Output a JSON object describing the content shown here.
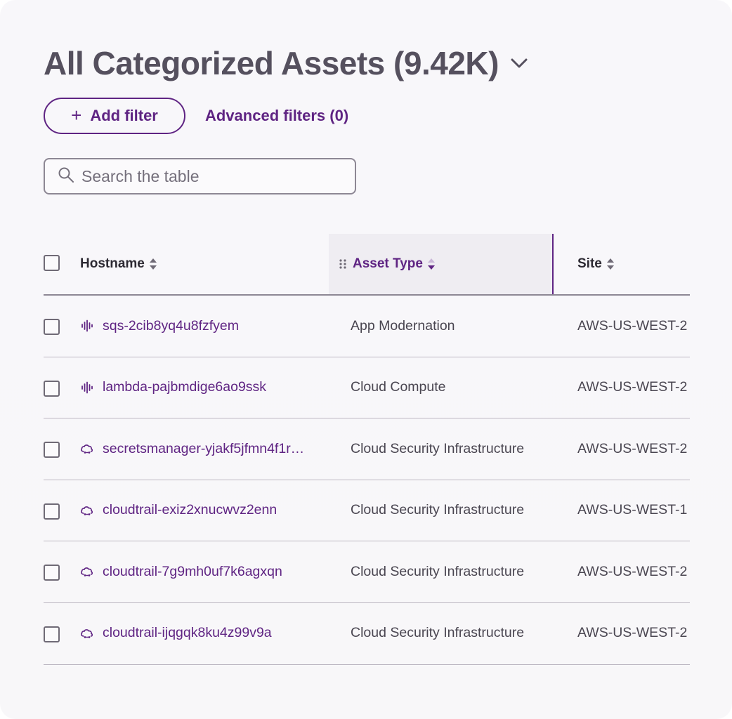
{
  "header": {
    "title": "All Categorized Assets (9.42K)"
  },
  "filters": {
    "add_filter_label": "Add filter",
    "advanced_filters_label": "Advanced filters (0)"
  },
  "search": {
    "placeholder": "Search the table"
  },
  "table": {
    "columns": {
      "hostname": "Hostname",
      "asset_type": "Asset Type",
      "site": "Site"
    },
    "active_sort_column": "Asset Type",
    "rows": [
      {
        "icon": "activity-wave-icon",
        "hostname": "sqs-2cib8yq4u8fzfyem",
        "asset_type": "App Modernation",
        "site": "AWS-US-WEST-2"
      },
      {
        "icon": "activity-wave-icon",
        "hostname": "lambda-pajbmdige6ao9ssk",
        "asset_type": "Cloud Compute",
        "site": "AWS-US-WEST-2"
      },
      {
        "icon": "cloud-network-icon",
        "hostname": "secretsmanager-yjakf5jfmn4f1r…",
        "asset_type": "Cloud Security Infrastructure",
        "site": "AWS-US-WEST-2"
      },
      {
        "icon": "cloud-network-icon",
        "hostname": "cloudtrail-exiz2xnucwvz2enn",
        "asset_type": "Cloud Security Infrastructure",
        "site": "AWS-US-WEST-1"
      },
      {
        "icon": "cloud-network-icon",
        "hostname": "cloudtrail-7g9mh0uf7k6agxqn",
        "asset_type": "Cloud Security Infrastructure",
        "site": "AWS-US-WEST-2"
      },
      {
        "icon": "cloud-network-icon",
        "hostname": "cloudtrail-ijqgqk8ku4z99v9a",
        "asset_type": "Cloud Security Infrastructure",
        "site": "AWS-US-WEST-2"
      }
    ]
  },
  "colors": {
    "accent": "#5f2483",
    "title": "#55505e",
    "text": "#2d2a33",
    "muted_text": "#4a4651",
    "active_header_bg": "#efedf2"
  }
}
